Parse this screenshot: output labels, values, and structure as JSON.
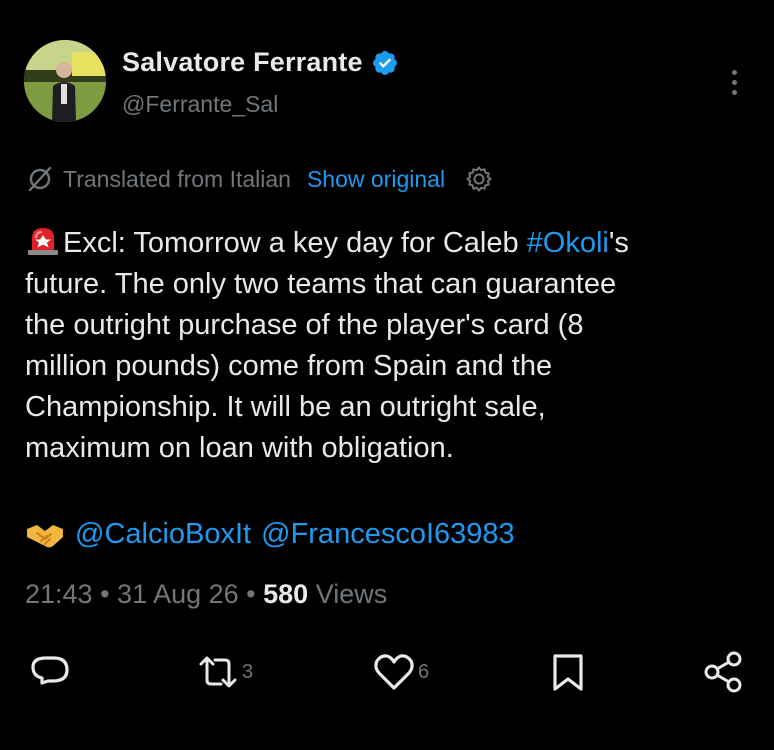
{
  "author": {
    "display_name": "Salvatore Ferrante",
    "handle": "@Ferrante_Sal",
    "verified": true
  },
  "translation": {
    "label": "Translated from Italian",
    "show_original": "Show original"
  },
  "tweet": {
    "line1_pre": "Excl: Tomorrow a key day for Caleb ",
    "line1_hashtag": "#Okoli",
    "line1_post": "'s",
    "line2": "future. The only two teams that can guarantee",
    "line3": "the outright purchase of the player's card (8",
    "line4": "million pounds) come from Spain and the",
    "line5": "Championship. It will be an outright sale,",
    "line6": "maximum on loan with obligation."
  },
  "mentions": [
    "@CalcioBoxIt",
    "@FrancescoI63983"
  ],
  "meta": {
    "time": "21:43",
    "sep1": " • ",
    "date": "31 Aug 26",
    "sep2": " • ",
    "views_count": "580",
    "views_label": " Views"
  },
  "actions": {
    "reply_count": "",
    "retweet_count": "3",
    "like_count": "6"
  },
  "colors": {
    "background": "#000000",
    "text": "#e7e9ea",
    "secondary": "#71767b",
    "link": "#1d9bf0"
  },
  "icons": {
    "verified": "verified-badge-icon",
    "more": "more-vertical-icon",
    "translate": "translate-slash-icon",
    "settings": "gear-icon",
    "siren": "siren-emoji-icon",
    "handshake": "handshake-emoji-icon",
    "reply": "reply-icon",
    "retweet": "retweet-icon",
    "like": "heart-icon",
    "bookmark": "bookmark-icon",
    "share": "share-icon"
  }
}
